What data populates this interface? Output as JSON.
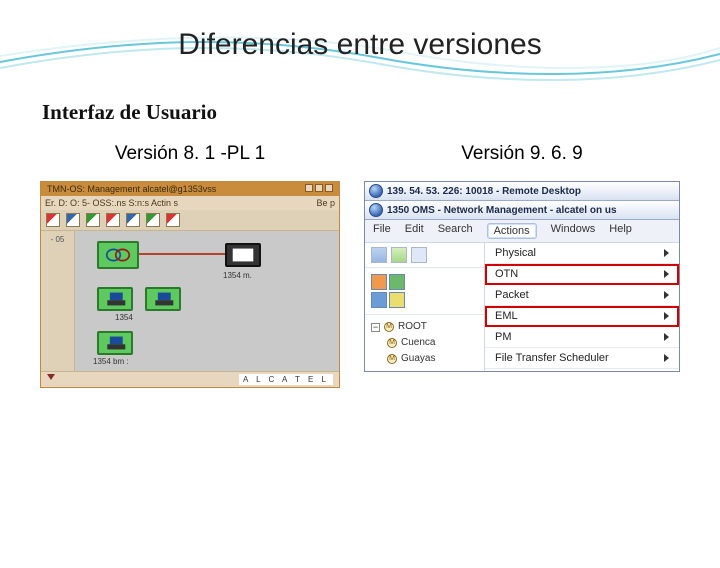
{
  "slide": {
    "title": "Diferencias entre versiones",
    "subtitle": "Interfaz de Usuario"
  },
  "columns": {
    "left_title": "Versión 8. 1 -PL 1",
    "right_title": "Versión 9. 6. 9"
  },
  "old_ui": {
    "title_text": "TMN-OS: Management  alcatel@g1353vss",
    "menu_left": "Er.  D:  O: 5-  OSS:.ns  S:n:s  Actin s",
    "menu_right": "Be p",
    "side_label": "- 05",
    "canvas_label": "1354 m.",
    "node_labels": [
      "",
      "",
      "1354",
      ""
    ],
    "node_bottom_label": "1354 bm :",
    "status_brand": "A L C A T E L"
  },
  "new_ui": {
    "titlebar1": "139. 54. 53. 226: 10018 - Remote Desktop",
    "titlebar2": "1350 OMS - Network Management - alcatel on us",
    "menu": [
      "File",
      "Edit",
      "Search",
      "Actions",
      "Windows",
      "Help"
    ],
    "menu_active_index": 3,
    "dropdown": [
      "Physical",
      "OTN",
      "Packet",
      "EML",
      "PM",
      "File Transfer Scheduler"
    ],
    "highlight_indices": [
      1,
      3
    ],
    "tree": {
      "root": "ROOT",
      "children": [
        "Cuenca",
        "Guayas"
      ]
    }
  }
}
